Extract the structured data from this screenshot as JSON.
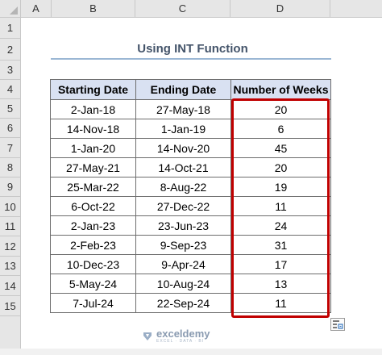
{
  "columns": [
    "A",
    "B",
    "C",
    "D"
  ],
  "rows": [
    "1",
    "2",
    "3",
    "4",
    "5",
    "6",
    "7",
    "8",
    "9",
    "10",
    "11",
    "12",
    "13",
    "14",
    "15",
    ""
  ],
  "sheet_title": "Using INT Function",
  "table": {
    "headers": [
      "Starting Date",
      "Ending Date",
      "Number of Weeks"
    ],
    "rows": [
      [
        "2-Jan-18",
        "27-May-18",
        "20"
      ],
      [
        "14-Nov-18",
        "1-Jan-19",
        "6"
      ],
      [
        "1-Jan-20",
        "14-Nov-20",
        "45"
      ],
      [
        "27-May-21",
        "14-Oct-21",
        "20"
      ],
      [
        "25-Mar-22",
        "8-Aug-22",
        "19"
      ],
      [
        "6-Oct-22",
        "27-Dec-22",
        "11"
      ],
      [
        "2-Jan-23",
        "23-Jun-23",
        "24"
      ],
      [
        "2-Feb-23",
        "9-Sep-23",
        "31"
      ],
      [
        "10-Dec-23",
        "9-Apr-24",
        "17"
      ],
      [
        "5-May-24",
        "10-Aug-24",
        "13"
      ],
      [
        "7-Jul-24",
        "22-Sep-24",
        "11"
      ]
    ]
  },
  "watermark": {
    "name": "exceldemy",
    "tagline": "EXCEL · DATA · BI"
  },
  "colors": {
    "header_fill": "#d9e1f2",
    "highlight_border": "#c00000",
    "title_color": "#44546a",
    "title_rule": "#9bb7d4"
  },
  "icons": [
    "quick-analysis-icon",
    "exceldemy-logo-icon"
  ]
}
